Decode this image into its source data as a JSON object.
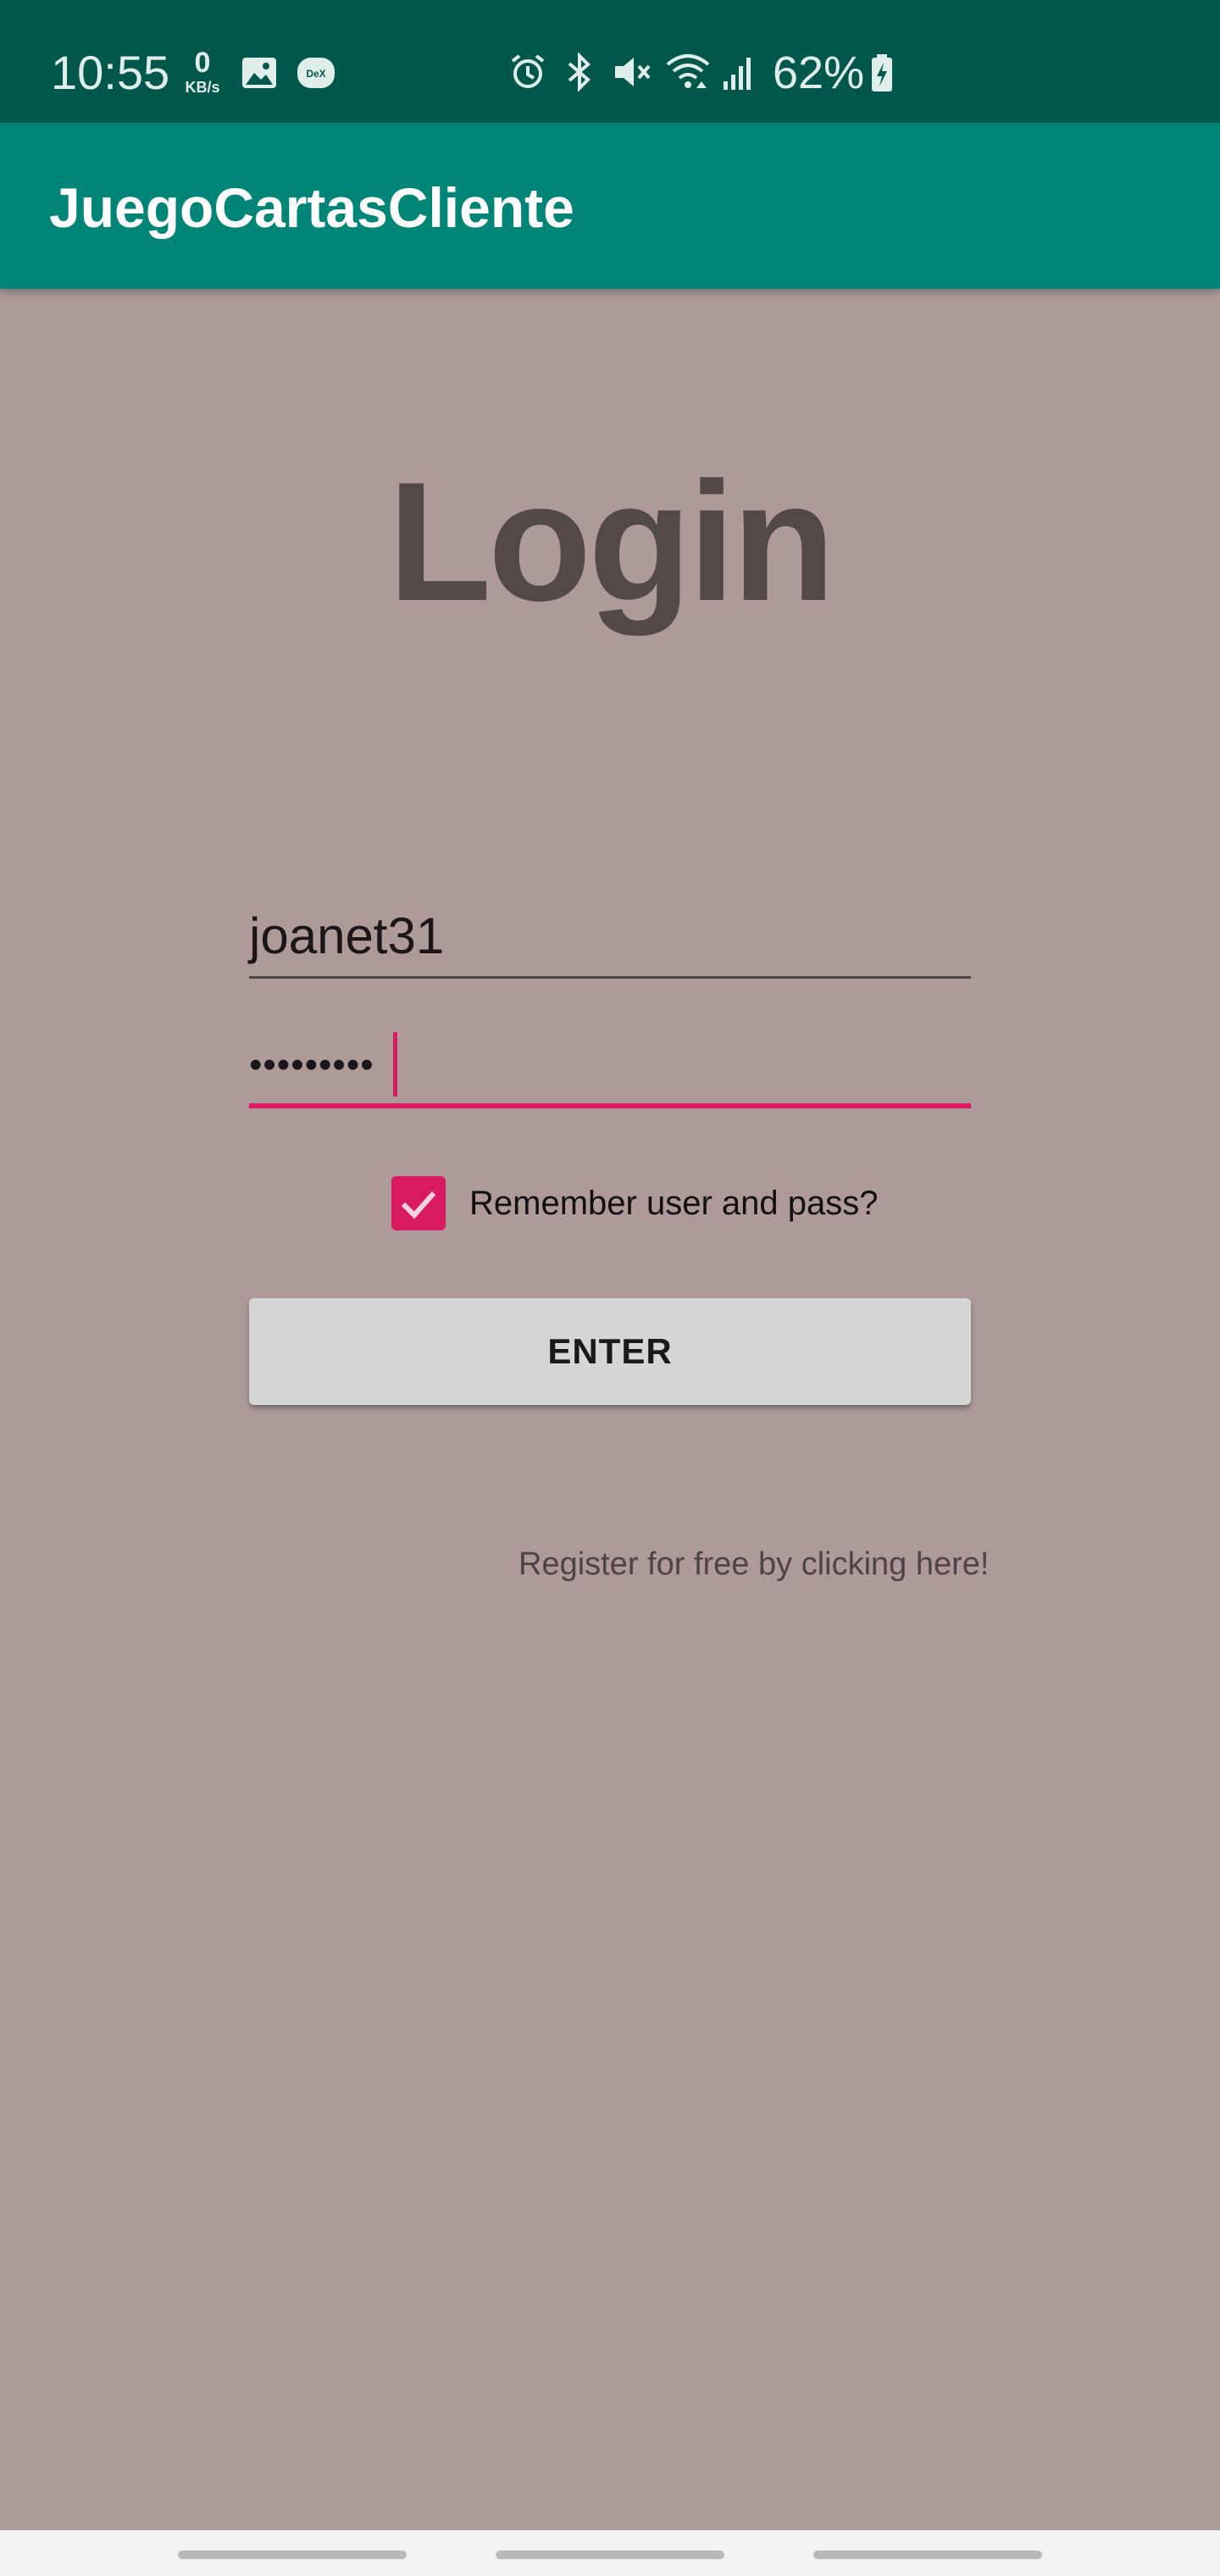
{
  "status_bar": {
    "time": "10:55",
    "net_speed_value": "0",
    "net_speed_unit": "KB/s",
    "battery_percent": "62%",
    "icons": [
      "image-icon",
      "dex-icon",
      "alarm-icon",
      "bluetooth-icon",
      "mute-icon",
      "wifi-icon",
      "signal-icon",
      "battery-charging-icon"
    ],
    "dex_label": "DeX"
  },
  "app_bar": {
    "title": "JuegoCartasCliente",
    "color": "#008576"
  },
  "login": {
    "heading": "Login",
    "username_value": "joanet31",
    "password_value": "•••••••••",
    "remember_label": "Remember user and pass?",
    "remember_checked": true,
    "enter_label": "ENTER",
    "register_text": "Register for free by clicking here!"
  },
  "colors": {
    "background": "#ad9a99",
    "status_bar": "#01574c",
    "accent": "#d81b60"
  }
}
